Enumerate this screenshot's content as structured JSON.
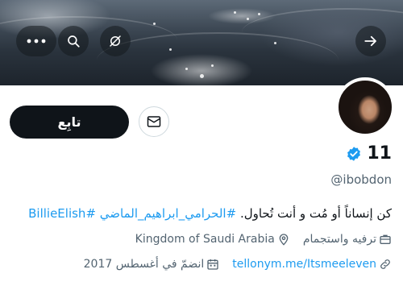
{
  "profile": {
    "display_name": "11",
    "handle": "@ibobdon",
    "verified_icon": "verified-badge-icon",
    "bio_text": "كن إنساناً أو مُت و أنت تُحاول.",
    "bio_hashtags": "#الحرامي_ابراهيم_الماضي #BillieElish",
    "category": "ترفيه واستجمام",
    "location": "Kingdom of Saudi Arabia",
    "website": "tellonym.me/Itsmeeleven",
    "joined": "انضمّ في أغسطس 2017"
  },
  "actions": {
    "follow_label": "تابِع"
  },
  "colors": {
    "accent": "#1d9bf0",
    "text": "#0f1419",
    "secondary": "#536471",
    "follow_bg": "#0f1419"
  },
  "icons": [
    "more-icon",
    "search-icon",
    "notifications-off-icon",
    "back-arrow-icon",
    "message-icon",
    "verified-badge-icon",
    "briefcase-icon",
    "location-pin-icon",
    "link-icon",
    "calendar-icon"
  ]
}
